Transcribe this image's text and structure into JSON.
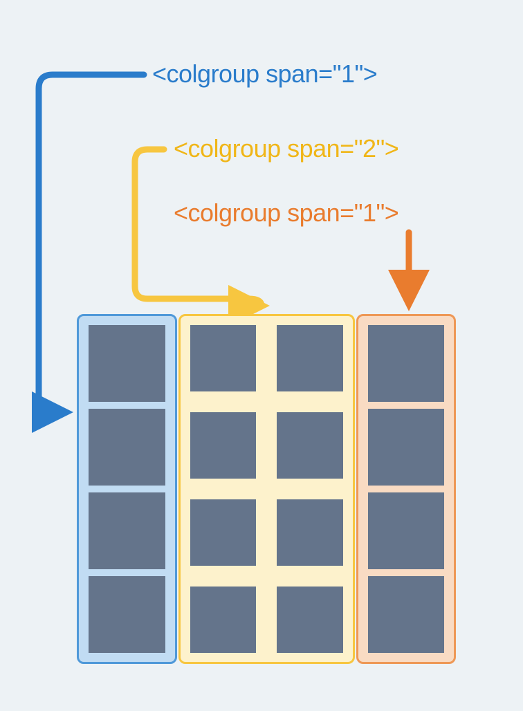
{
  "labels": {
    "blue": "<colgroup span=\"1\">",
    "yellow": "<colgroup span=\"2\">",
    "orange": "<colgroup span=\"1\">"
  },
  "colors": {
    "blue": "#2a7ccb",
    "yellow": "#f0b618",
    "orange": "#e97c2e",
    "cell": "#64748b",
    "bg": "#edf2f5",
    "group_blue_border": "#4f99d9",
    "group_blue_fill": "#c1dcf3",
    "group_yellow_border": "#f7c640",
    "group_yellow_fill": "#fdf2cc",
    "group_orange_border": "#ee9856",
    "group_orange_fill": "#f9dbc3"
  },
  "structure": {
    "groups": [
      {
        "span": 1,
        "color": "blue"
      },
      {
        "span": 2,
        "color": "yellow"
      },
      {
        "span": 1,
        "color": "orange"
      }
    ],
    "rows": 4
  }
}
